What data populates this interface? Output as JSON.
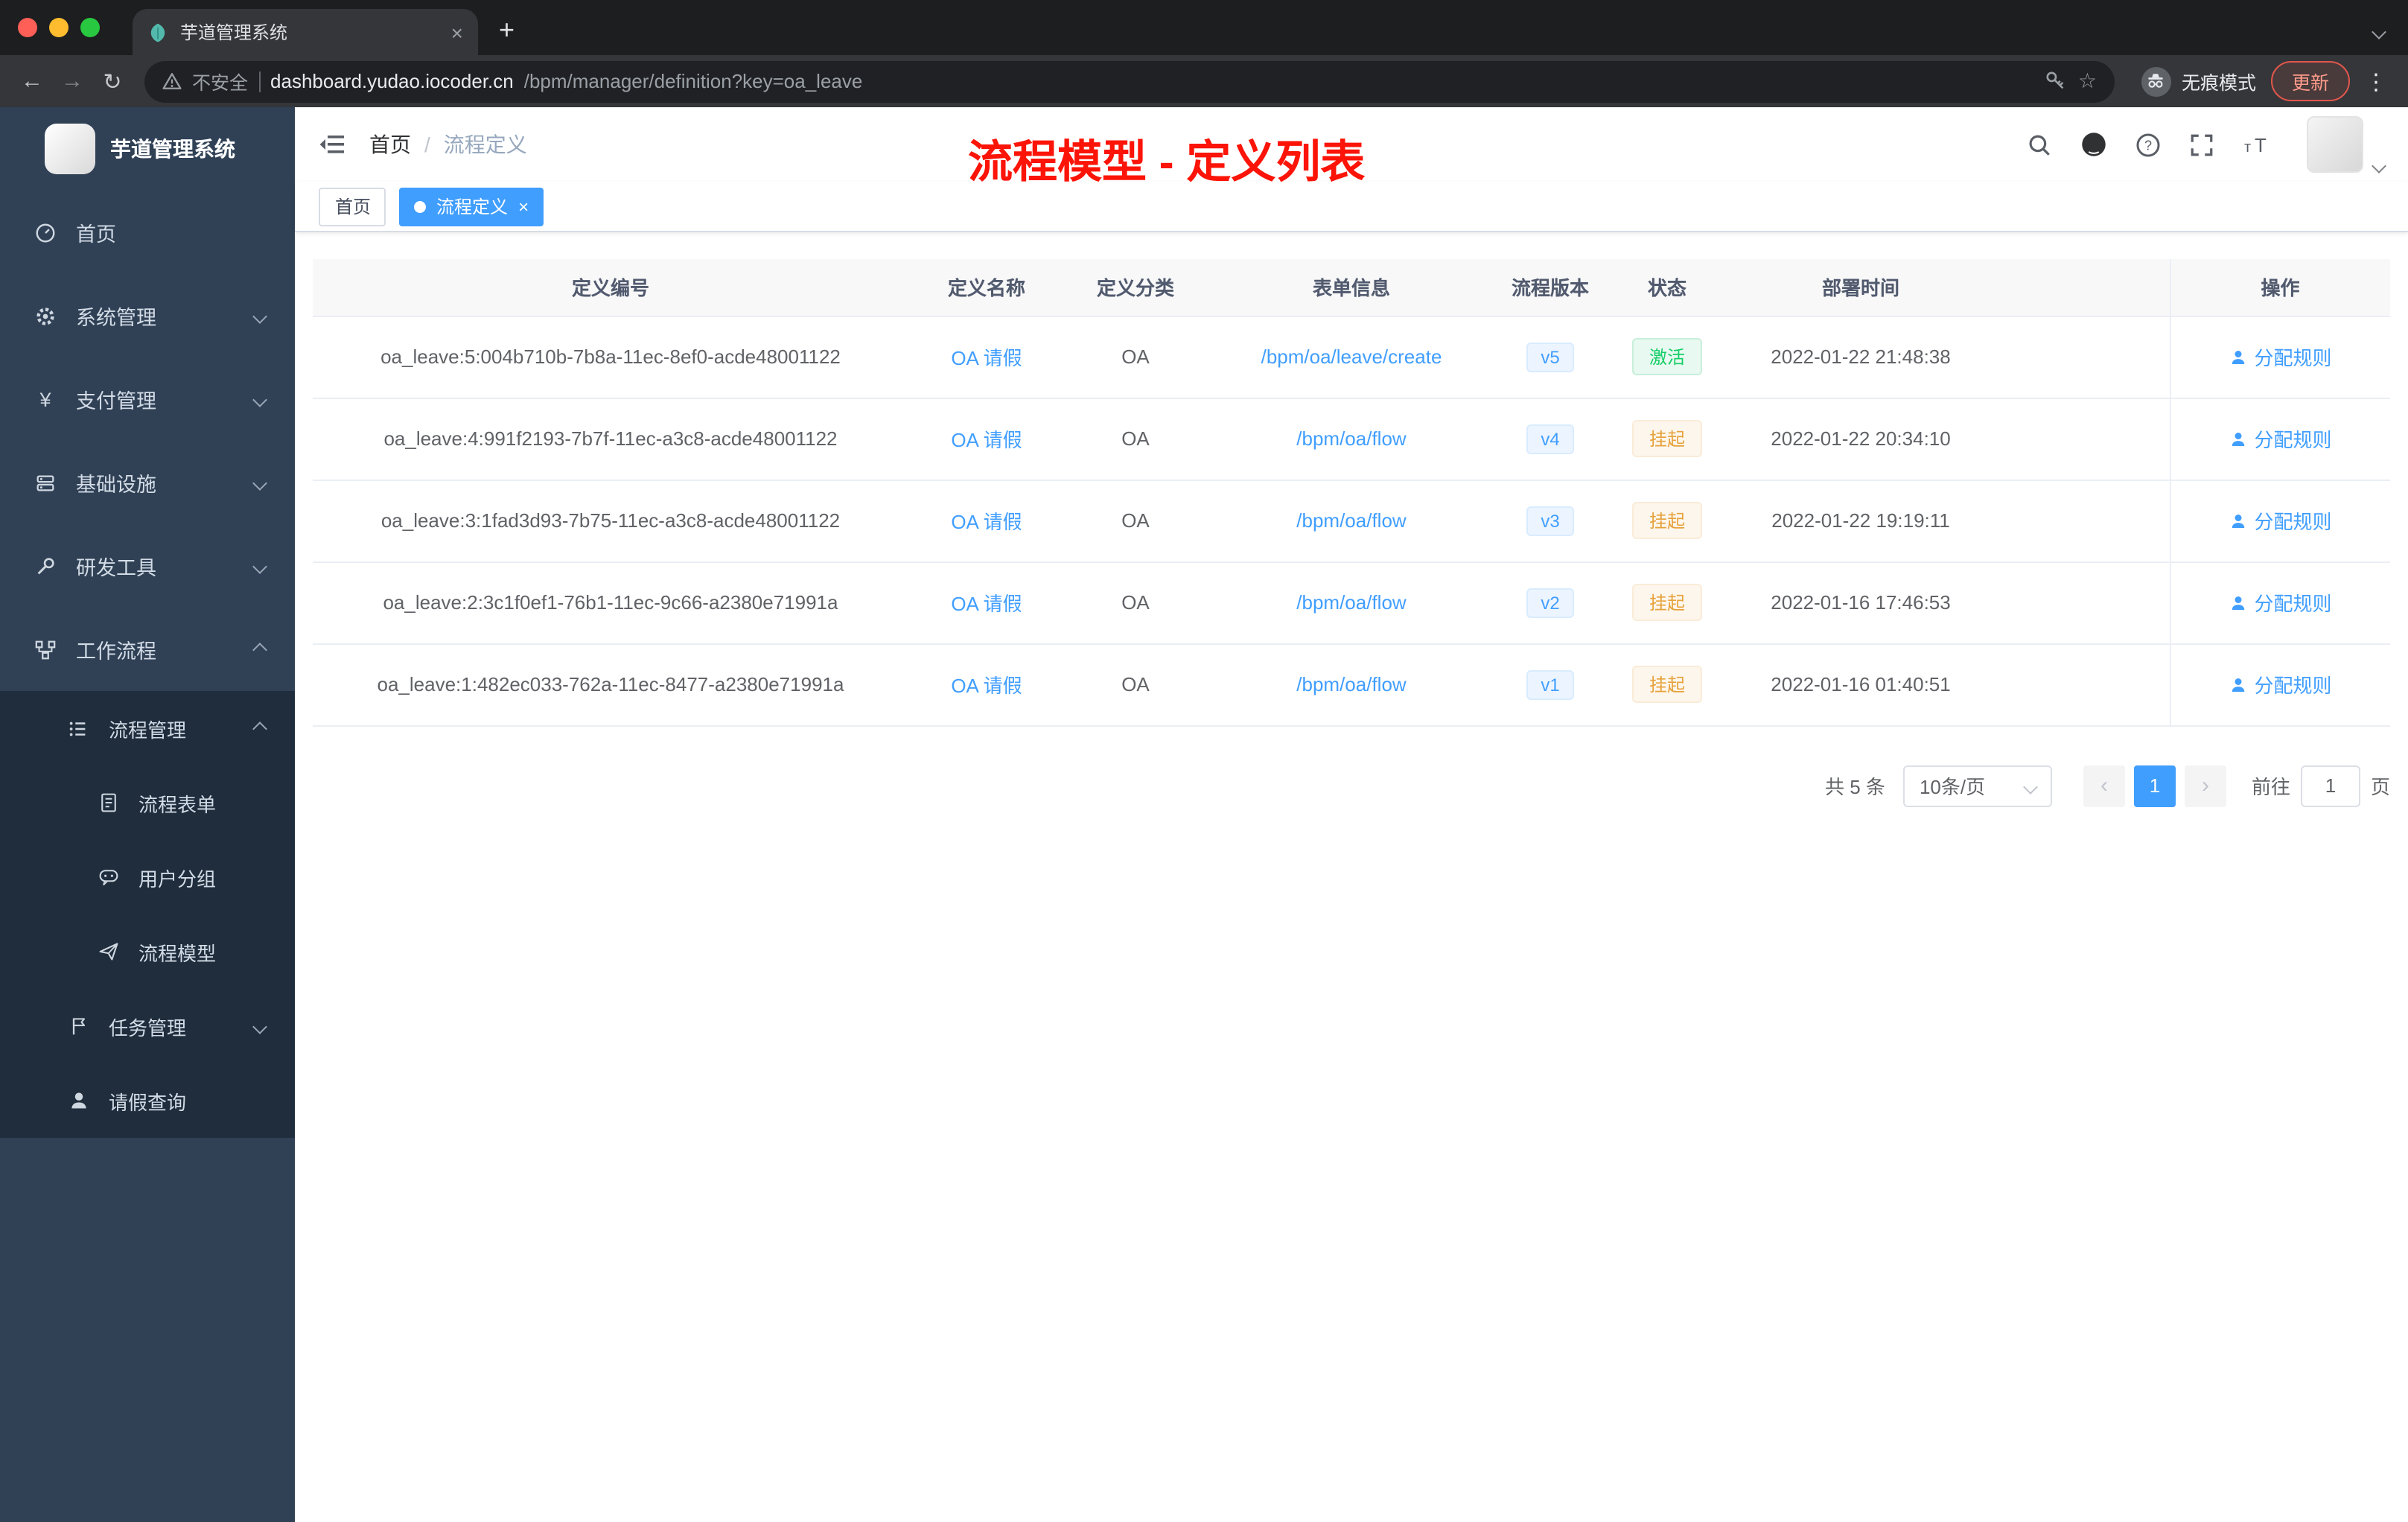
{
  "colors": {
    "accent": "#409eff",
    "success": "#13ce66",
    "warning": "#e6a23c",
    "sidebar_bg": "#304156",
    "submenu_bg": "#1f2d3d",
    "annotation_red": "#fb1407"
  },
  "icons": {
    "close": "×",
    "plus": "+",
    "kebab": "⋮",
    "star": "☆",
    "back": "←",
    "forward": "→",
    "reload": "↻",
    "prev": "‹",
    "next": "›",
    "yen": "¥"
  },
  "browser": {
    "tab_title": "芋道管理系统",
    "security_label": "不安全",
    "url_host": "dashboard.yudao.iocoder.cn",
    "url_path": "/bpm/manager/definition?key=oa_leave",
    "incognito_label": "无痕模式",
    "update_label": "更新"
  },
  "sidebar": {
    "logo_title": "芋道管理系统",
    "items": [
      {
        "label": "首页"
      },
      {
        "label": "系统管理"
      },
      {
        "label": "支付管理"
      },
      {
        "label": "基础设施"
      },
      {
        "label": "研发工具"
      },
      {
        "label": "工作流程"
      },
      {
        "label": "流程管理"
      },
      {
        "label": "流程表单"
      },
      {
        "label": "用户分组"
      },
      {
        "label": "流程模型"
      },
      {
        "label": "任务管理"
      },
      {
        "label": "请假查询"
      }
    ]
  },
  "navbar": {
    "breadcrumb_home": "首页",
    "breadcrumb_current": "流程定义",
    "annotation": "流程模型 - 定义列表"
  },
  "tags": {
    "home": "首页",
    "current": "流程定义"
  },
  "table": {
    "columns": {
      "id": "定义编号",
      "name": "定义名称",
      "category": "定义分类",
      "form": "表单信息",
      "version": "流程版本",
      "status": "状态",
      "deploy_time": "部署时间",
      "action": "操作"
    },
    "rows": [
      {
        "id": "oa_leave:5:004b710b-7b8a-11ec-8ef0-acde48001122",
        "name": "OA 请假",
        "category": "OA",
        "form": "/bpm/oa/leave/create",
        "version": "v5",
        "status": "激活",
        "status_type": "success",
        "deploy_time": "2022-01-22 21:48:38",
        "action": "分配规则"
      },
      {
        "id": "oa_leave:4:991f2193-7b7f-11ec-a3c8-acde48001122",
        "name": "OA 请假",
        "category": "OA",
        "form": "/bpm/oa/flow",
        "version": "v4",
        "status": "挂起",
        "status_type": "warning",
        "deploy_time": "2022-01-22 20:34:10",
        "action": "分配规则"
      },
      {
        "id": "oa_leave:3:1fad3d93-7b75-11ec-a3c8-acde48001122",
        "name": "OA 请假",
        "category": "OA",
        "form": "/bpm/oa/flow",
        "version": "v3",
        "status": "挂起",
        "status_type": "warning",
        "deploy_time": "2022-01-22 19:19:11",
        "action": "分配规则"
      },
      {
        "id": "oa_leave:2:3c1f0ef1-76b1-11ec-9c66-a2380e71991a",
        "name": "OA 请假",
        "category": "OA",
        "form": "/bpm/oa/flow",
        "version": "v2",
        "status": "挂起",
        "status_type": "warning",
        "deploy_time": "2022-01-16 17:46:53",
        "action": "分配规则"
      },
      {
        "id": "oa_leave:1:482ec033-762a-11ec-8477-a2380e71991a",
        "name": "OA 请假",
        "category": "OA",
        "form": "/bpm/oa/flow",
        "version": "v1",
        "status": "挂起",
        "status_type": "warning",
        "deploy_time": "2022-01-16 01:40:51",
        "action": "分配规则"
      }
    ]
  },
  "pagination": {
    "total": "共 5 条",
    "page_size": "10条/页",
    "current_page": "1",
    "goto_label": "前往",
    "goto_value": "1",
    "unit_label": "页"
  }
}
